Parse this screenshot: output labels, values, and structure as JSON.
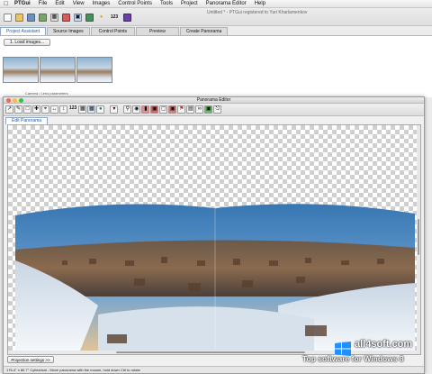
{
  "menubar": {
    "app": "PTGui",
    "items": [
      "File",
      "Edit",
      "View",
      "Images",
      "Control Points",
      "Tools",
      "Project",
      "Panorama Editor",
      "Help"
    ]
  },
  "main": {
    "title": "Untitled * - PTGui registered to Yuri Kharlamenkov",
    "tabs": [
      {
        "label": "Project Assistant"
      },
      {
        "label": "Source Images"
      },
      {
        "label": "Control Points"
      },
      {
        "label": "Preview"
      },
      {
        "label": "Create Panorama"
      }
    ],
    "load_button": "1. Load images...",
    "camera_label": "Camera / Lens parameters"
  },
  "editor": {
    "title": "Panorama Editor",
    "tab": "Edit Panorama",
    "toolbar_counter": "123",
    "projection_button": "Projection settings >>",
    "status": "176.4° x 80.7° Cylindrical - Move panorama with the mouse, hold down Ctrl to rotate"
  },
  "watermark": {
    "site": "all4soft.com",
    "tagline": "Top software for Windows 8"
  },
  "colors": {
    "accent": "#1a5fb4",
    "sky": "#4a8cc6",
    "windows_logo": "#1e90ff"
  }
}
